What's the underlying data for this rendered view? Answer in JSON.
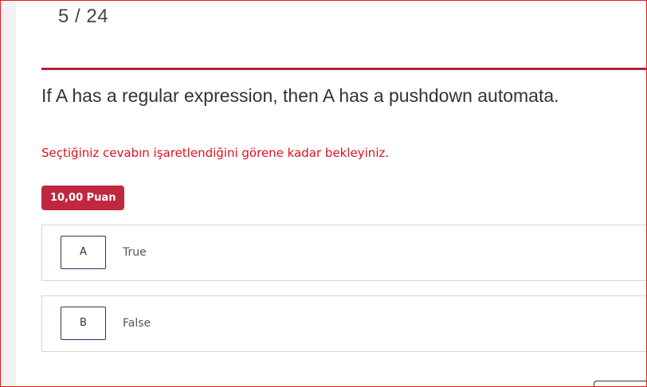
{
  "quiz": {
    "counter": "5 / 24",
    "question": "If A has a regular expression, then A has a pushdown automata.",
    "warning": "Seçtiğiniz cevabın işaretlendiğini görene kadar bekleyiniz.",
    "points": "10,00 Puan",
    "options": [
      {
        "letter": "A",
        "text": "True"
      },
      {
        "letter": "B",
        "text": "False"
      }
    ]
  },
  "colors": {
    "accent": "#b0243b",
    "badge": "#c0283f",
    "warning": "#e0101e",
    "frame": "#e31b23"
  }
}
